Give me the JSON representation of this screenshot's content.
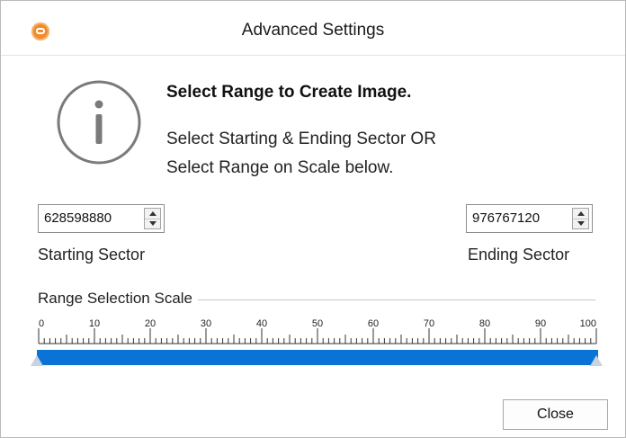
{
  "window": {
    "title": "Advanced Settings",
    "app_icon": "app-logo-icon"
  },
  "info": {
    "icon": "info-icon",
    "heading": "Select Range to Create Image.",
    "message_line1": "Select Starting & Ending Sector OR",
    "message_line2": "Select Range on Scale below."
  },
  "starting_sector": {
    "value": "628598880",
    "label": "Starting Sector"
  },
  "ending_sector": {
    "value": "976767120",
    "label": "Ending Sector"
  },
  "scale": {
    "title": "Range Selection Scale",
    "ticks": [
      "0",
      "10",
      "20",
      "30",
      "40",
      "50",
      "60",
      "70",
      "80",
      "90",
      "100"
    ],
    "range_start_percent": 0,
    "range_end_percent": 100,
    "track_color": "#0a74d6"
  },
  "buttons": {
    "close_label": "Close"
  }
}
